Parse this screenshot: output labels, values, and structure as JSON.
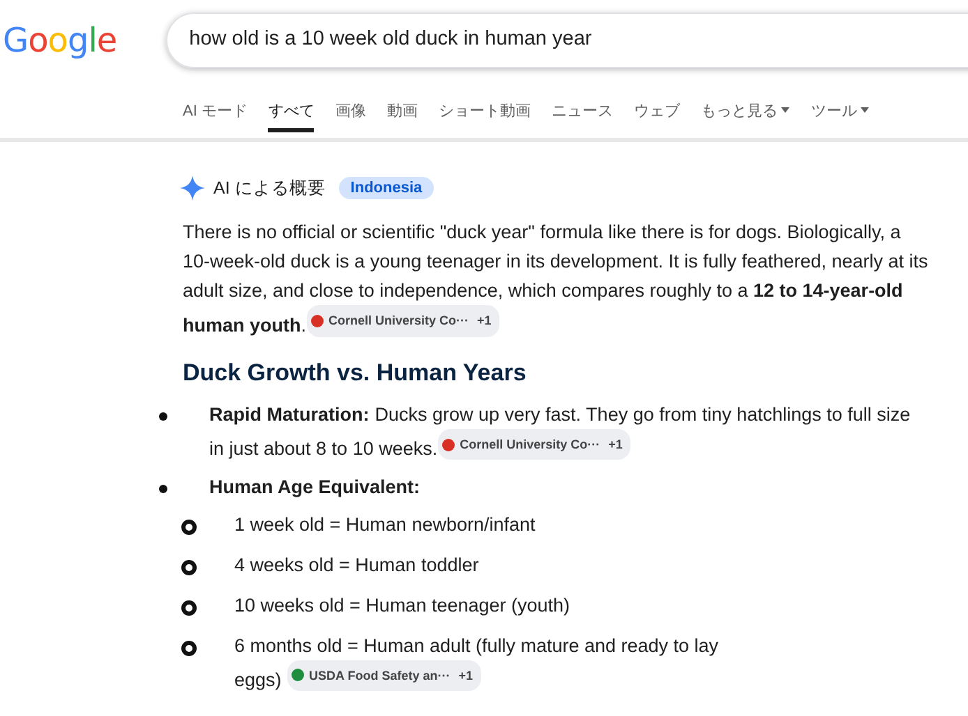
{
  "header": {
    "logo": "Google",
    "query": "how old is a 10 week old duck in human year"
  },
  "tabs": [
    {
      "label": "AI モード",
      "selected": false,
      "dropdown": false
    },
    {
      "label": "すべて",
      "selected": true,
      "dropdown": false
    },
    {
      "label": "画像",
      "selected": false,
      "dropdown": false
    },
    {
      "label": "動画",
      "selected": false,
      "dropdown": false
    },
    {
      "label": "ショート動画",
      "selected": false,
      "dropdown": false
    },
    {
      "label": "ニュース",
      "selected": false,
      "dropdown": false
    },
    {
      "label": "ウェブ",
      "selected": false,
      "dropdown": false
    },
    {
      "label": "もっと見る",
      "selected": false,
      "dropdown": true
    },
    {
      "label": "ツール",
      "selected": false,
      "dropdown": true
    }
  ],
  "overview": {
    "label": "AI による概要",
    "region": "Indonesia",
    "intro": {
      "text": "There is no official or scientific \"duck year\" formula like there is for dogs. Biologically, a 10-week-old duck is a young teenager in its development. It is fully feathered, nearly at its adult size, and close to independence, which compares roughly to a **12 to 14-year-old human youth**.",
      "citation": {
        "source": "Cornell University Co···",
        "more": "+1",
        "color": "#d93025"
      }
    },
    "heading": "Duck Growth vs. Human Years",
    "bullets": [
      {
        "label": "Rapid Maturation:",
        "text": "Ducks grow up very fast. They go from tiny hatchlings to full size in just about 8 to 10 weeks.",
        "citation": {
          "source": "Cornell University Co···",
          "more": "+1",
          "color": "#d93025"
        }
      },
      {
        "label": "Human Age Equivalent:",
        "children": [
          {
            "text": "1 week old = Human newborn/infant"
          },
          {
            "text": "4 weeks old = Human toddler"
          },
          {
            "text": "10 weeks old = Human teenager (youth)"
          },
          {
            "text": "6 months old = Human adult (fully mature and ready to lay eggs)",
            "citation": {
              "source": "USDA Food Safety an···",
              "more": "+1",
              "color": "#1e8e3e"
            }
          }
        ]
      }
    ]
  }
}
